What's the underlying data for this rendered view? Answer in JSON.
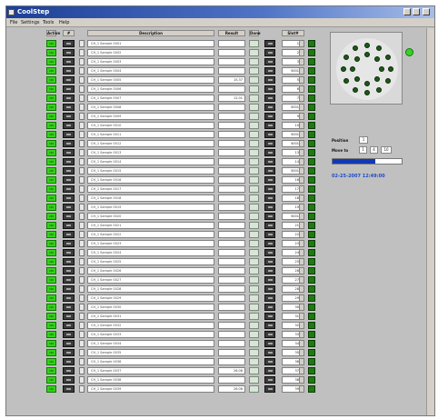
{
  "window": {
    "title": "CoolStep",
    "controls": [
      "minimize-icon",
      "maximize-icon",
      "close-icon"
    ]
  },
  "menu": [
    "File",
    "Settings",
    "Tools",
    "Help"
  ],
  "columns": {
    "enable": "Active",
    "id": "#",
    "name": "Description",
    "value": "Result",
    "check": "Done",
    "action": "",
    "slot": "Slot#"
  },
  "rows": [
    {
      "enable": "ON",
      "name": "CH_1 Sample 0001",
      "value": "",
      "slot": "1"
    },
    {
      "enable": "ON",
      "name": "CH_1 Sample 0002",
      "value": "",
      "slot": "2"
    },
    {
      "enable": "ON",
      "name": "CH_1 Sample 0003",
      "value": "",
      "slot": "3"
    },
    {
      "enable": "ON",
      "name": "CH_1 Sample 0004",
      "value": "",
      "slot": "5001"
    },
    {
      "enable": "ON",
      "name": "CH_1 Sample 0005",
      "value": "15.37",
      "slot": "5"
    },
    {
      "enable": "ON",
      "name": "CH_1 Sample 0006",
      "value": "",
      "slot": "6"
    },
    {
      "enable": "ON",
      "name": "CH_1 Sample 0007",
      "value": "12.01",
      "slot": "7"
    },
    {
      "enable": "ON",
      "name": "CH_1 Sample 0008",
      "value": "",
      "slot": "5001"
    },
    {
      "enable": "ON",
      "name": "CH_1 Sample 0009",
      "value": "",
      "slot": "9"
    },
    {
      "enable": "ON",
      "name": "CH_1 Sample 0010",
      "value": "",
      "slot": "10"
    },
    {
      "enable": "ON",
      "name": "CH_1 Sample 0011",
      "value": "",
      "slot": "5001"
    },
    {
      "enable": "ON",
      "name": "CH_1 Sample 0012",
      "value": "",
      "slot": "5001"
    },
    {
      "enable": "ON",
      "name": "CH_1 Sample 0013",
      "value": "",
      "slot": "13"
    },
    {
      "enable": "ON",
      "name": "CH_1 Sample 0014",
      "value": "",
      "slot": "14"
    },
    {
      "enable": "ON",
      "name": "CH_1 Sample 0015",
      "value": "",
      "slot": "5001"
    },
    {
      "enable": "ON",
      "name": "CH_1 Sample 0016",
      "value": "",
      "slot": "16"
    },
    {
      "enable": "ON",
      "name": "CH_1 Sample 0017",
      "value": "",
      "slot": "17"
    },
    {
      "enable": "ON",
      "name": "CH_1 Sample 0018",
      "value": "",
      "slot": "18"
    },
    {
      "enable": "ON",
      "name": "CH_1 Sample 0019",
      "value": "",
      "slot": "19"
    },
    {
      "enable": "ON",
      "name": "CH_1 Sample 0020",
      "value": "",
      "slot": "5001"
    },
    {
      "enable": "ON",
      "name": "CH_1 Sample 0021",
      "value": "",
      "slot": "21"
    },
    {
      "enable": "ON",
      "name": "CH_1 Sample 0022",
      "value": "",
      "slot": "22"
    },
    {
      "enable": "ON",
      "name": "CH_1 Sample 0023",
      "value": "",
      "slot": "23"
    },
    {
      "enable": "ON",
      "name": "CH_1 Sample 0024",
      "value": "",
      "slot": "24"
    },
    {
      "enable": "ON",
      "name": "CH_1 Sample 0025",
      "value": "",
      "slot": "25"
    },
    {
      "enable": "ON",
      "name": "CH_1 Sample 0026",
      "value": "",
      "slot": "26"
    },
    {
      "enable": "ON",
      "name": "CH_1 Sample 0027",
      "value": "",
      "slot": "27"
    },
    {
      "enable": "ON",
      "name": "CH_1 Sample 0028",
      "value": "",
      "slot": "28"
    },
    {
      "enable": "ON",
      "name": "CH_1 Sample 0029",
      "value": "",
      "slot": "29"
    },
    {
      "enable": "ON",
      "name": "CH_1 Sample 0030",
      "value": "",
      "slot": "30"
    },
    {
      "enable": "ON",
      "name": "CH_1 Sample 0031",
      "value": "",
      "slot": "31"
    },
    {
      "enable": "ON",
      "name": "CH_1 Sample 0032",
      "value": "",
      "slot": "32"
    },
    {
      "enable": "ON",
      "name": "CH_1 Sample 0033",
      "value": "",
      "slot": "33"
    },
    {
      "enable": "ON",
      "name": "CH_1 Sample 0034",
      "value": "",
      "slot": "34"
    },
    {
      "enable": "ON",
      "name": "CH_1 Sample 0035",
      "value": "",
      "slot": "35"
    },
    {
      "enable": "ON",
      "name": "CH_1 Sample 0036",
      "value": "",
      "slot": "36"
    },
    {
      "enable": "ON",
      "name": "CH_1 Sample 0037",
      "value": "26.06",
      "slot": "37"
    },
    {
      "enable": "ON",
      "name": "CH_1 Sample 0038",
      "value": "",
      "slot": "38"
    },
    {
      "enable": "ON",
      "name": "CH_1 Sample 0039",
      "value": "26.06",
      "slot": "39"
    }
  ],
  "carousel": {
    "indicator": "carousel-ready-led"
  },
  "controls_panel": {
    "position_label": "Position",
    "position_value": "1",
    "move_label": "Move to",
    "move_from": "1",
    "move_to": "4",
    "move_extra": "10",
    "progress": 0.62,
    "status": "02-25-2007  12:49:00"
  },
  "colors": {
    "enabled_green": "#33d11a",
    "led_green": "#1f7a10",
    "title_blue": "#1c3f97",
    "status_blue": "#1b4cc8"
  }
}
